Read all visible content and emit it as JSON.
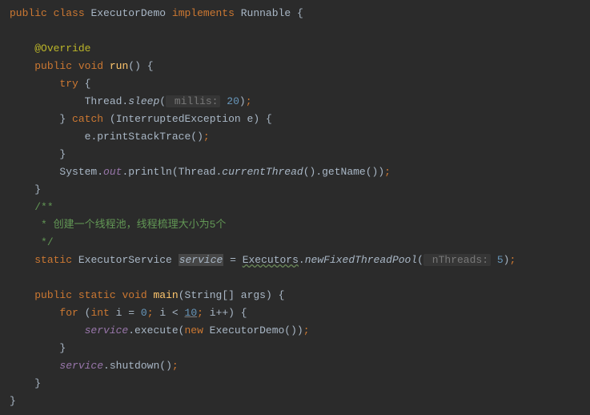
{
  "code": {
    "l1_public": "public",
    "l1_class": "class",
    "l1_name": "ExecutorDemo",
    "l1_implements": "implements",
    "l1_iface": "Runnable",
    "l1_brace": " {",
    "l3_annotation": "@Override",
    "l4_public": "public",
    "l4_void": "void",
    "l4_run": "run",
    "l4_paren": "()",
    "l4_brace": " {",
    "l5_try": "try",
    "l5_brace": " {",
    "l6_thread": "Thread.",
    "l6_sleep": "sleep",
    "l6_open": "(",
    "l6_hint": " millis:",
    "l6_val": "20",
    "l6_close": ")",
    "l6_semi": ";",
    "l7_close": "}",
    "l7_catch": "catch",
    "l7_open": "(",
    "l7_type": "InterruptedException",
    "l7_var": "e",
    "l7_close2": ")",
    "l7_brace": " {",
    "l8_e": "e",
    "l8_dot": ".",
    "l8_print": "printStackTrace",
    "l8_paren": "()",
    "l8_semi": ";",
    "l9_close": "}",
    "l10_sys": "System.",
    "l10_out": "out",
    "l10_dot": ".",
    "l10_println": "println",
    "l10_open": "(",
    "l10_thr": "Thread.",
    "l10_cur": "currentThread",
    "l10_p1": "()",
    "l10_dot2": ".",
    "l10_get": "getName",
    "l10_p2": "()",
    "l10_close": ")",
    "l10_semi": ";",
    "l11_close": "}",
    "l12_a": "/**",
    "l12_b": " * 创建一个线程池，线程梳理大小为5个",
    "l12_c": " */",
    "l13_static": "static",
    "l13_type": "ExecutorService",
    "l13_var": "service",
    "l13_eq": " = ",
    "l13_exec": "Executors",
    "l13_dot": ".",
    "l13_new": "newFixedThreadPool",
    "l13_open": "(",
    "l13_hint": " nThreads:",
    "l13_val": "5",
    "l13_close": ")",
    "l13_semi": ";",
    "l15_public": "public",
    "l15_static": "static",
    "l15_void": "void",
    "l15_main": "main",
    "l15_open": "(",
    "l15_str": "String",
    "l15_arr": "[]",
    "l15_args": "args",
    "l15_close": ")",
    "l15_brace": " {",
    "l16_for": "for",
    "l16_open": "(",
    "l16_int": "int",
    "l16_i": "i",
    "l16_eq": " = ",
    "l16_zero": "0",
    "l16_semi1": ";",
    "l16_cond": " i < ",
    "l16_ten": "10",
    "l16_semi2": ";",
    "l16_inc": " i",
    "l16_pp": "++",
    "l16_close": ")",
    "l16_brace": " {",
    "l17_svc": "service",
    "l17_dot": ".",
    "l17_exec": "execute",
    "l17_open": "(",
    "l17_new": "new",
    "l17_cls": " ExecutorDemo",
    "l17_paren": "()",
    "l17_close": ")",
    "l17_semi": ";",
    "l18_close": "}",
    "l19_svc": "service",
    "l19_dot": ".",
    "l19_shut": "shutdown",
    "l19_paren": "()",
    "l19_semi": ";",
    "l20_close": "}",
    "l21_close": "}"
  }
}
